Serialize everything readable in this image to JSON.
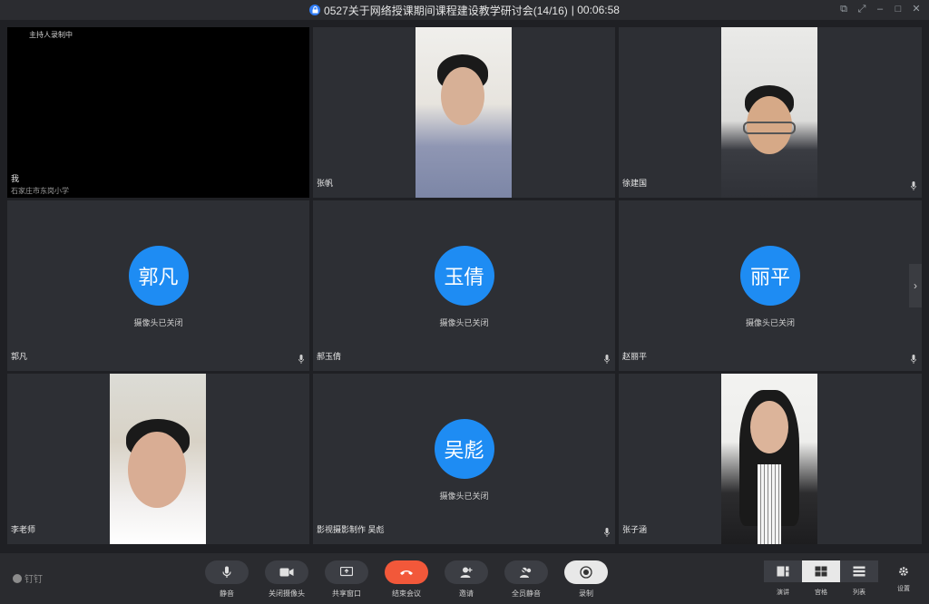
{
  "window": {
    "title": "0527关于网络授课期间课程建设教学研讨会(14/16)",
    "timer": "| 00:06:58"
  },
  "tiles": [
    {
      "name": "我",
      "sub": "石家庄市东岗小学",
      "recording": "主持人录制中"
    },
    {
      "name": "张帆"
    },
    {
      "name": "徐建国"
    },
    {
      "name": "郭凡",
      "avatar": "郭凡",
      "status": "摄像头已关闭"
    },
    {
      "name": "郝玉倩",
      "avatar": "玉倩",
      "status": "摄像头已关闭"
    },
    {
      "name": "赵丽平",
      "avatar": "丽平",
      "status": "摄像头已关闭"
    },
    {
      "name": "李老师"
    },
    {
      "name": "影视摄影制作 吴彪",
      "avatar": "吴彪",
      "status": "摄像头已关闭"
    },
    {
      "name": "张子涵"
    }
  ],
  "brand": "钉钉",
  "toolbar": {
    "mute": "静音",
    "camera_off": "关闭摄像头",
    "share": "共享窗口",
    "end": "结束会议",
    "invite": "邀请",
    "mute_all": "全员静音",
    "record": "录制"
  },
  "views": {
    "speaker": "演讲",
    "grid": "宫格",
    "list": "列表",
    "settings": "设置"
  },
  "colors": {
    "accent": "#1e8cf3",
    "end_call": "#f2583a",
    "background": "#1f2024"
  }
}
